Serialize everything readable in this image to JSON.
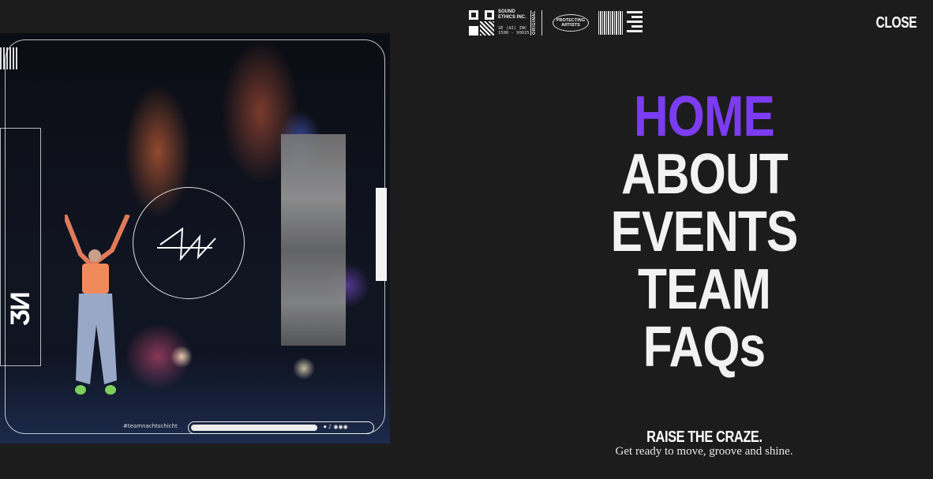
{
  "header": {
    "badges": {
      "company_name": "SOUND ETHICS INC.",
      "company_code": "SE (AI) INC 1500 - 90025",
      "original_label": "ORIGINAL",
      "protect_label": "PROTECTING ARTISTS"
    },
    "close_label": "CLOSE"
  },
  "artwork": {
    "hashtag": "#teamnachtschicht",
    "controls": "⏺ ♪ ◉◉◉"
  },
  "nav": {
    "items": [
      {
        "label": "HOME",
        "active": true
      },
      {
        "label": "ABOUT",
        "active": false
      },
      {
        "label": "EVENTS",
        "active": false
      },
      {
        "label": "TEAM",
        "active": false
      },
      {
        "label": "FAQs",
        "active": false
      }
    ]
  },
  "tagline": {
    "title": "RAISE THE CRAZE.",
    "subtitle": "Get ready to move, groove and shine."
  },
  "colors": {
    "background": "#1c1c1c",
    "accent": "#7c3cf2",
    "text": "#f2f2f2"
  }
}
